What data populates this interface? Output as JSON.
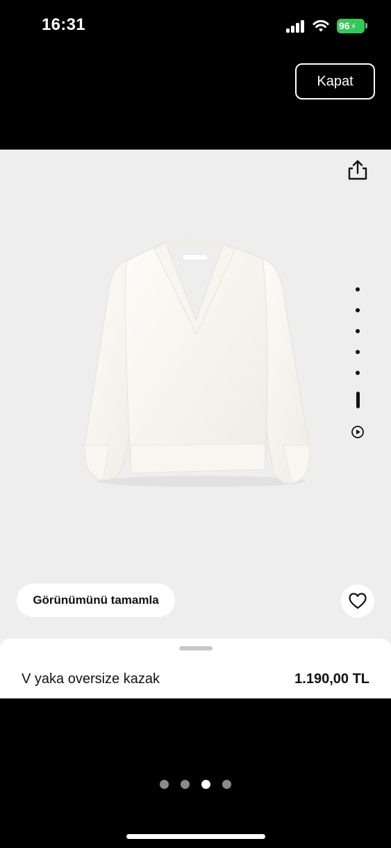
{
  "status_bar": {
    "time": "16:31",
    "battery": "96",
    "battery_color": "#34c759",
    "icons": [
      "signal-icon",
      "wifi-icon",
      "battery-icon"
    ]
  },
  "header": {
    "close_label": "Kapat"
  },
  "gallery": {
    "image_alt_icon": "sweater-image",
    "dots_count": 6,
    "active_dot": 5,
    "share_icon": "share-icon",
    "video_icon": "play-circle-icon"
  },
  "actions": {
    "complete_look_label": "Görünümünü tamamla",
    "favorite_icon": "heart-icon"
  },
  "product": {
    "name": "V yaka oversize kazak",
    "price": "1.190,00 TL"
  },
  "pager": {
    "count": 4,
    "active": 2
  }
}
